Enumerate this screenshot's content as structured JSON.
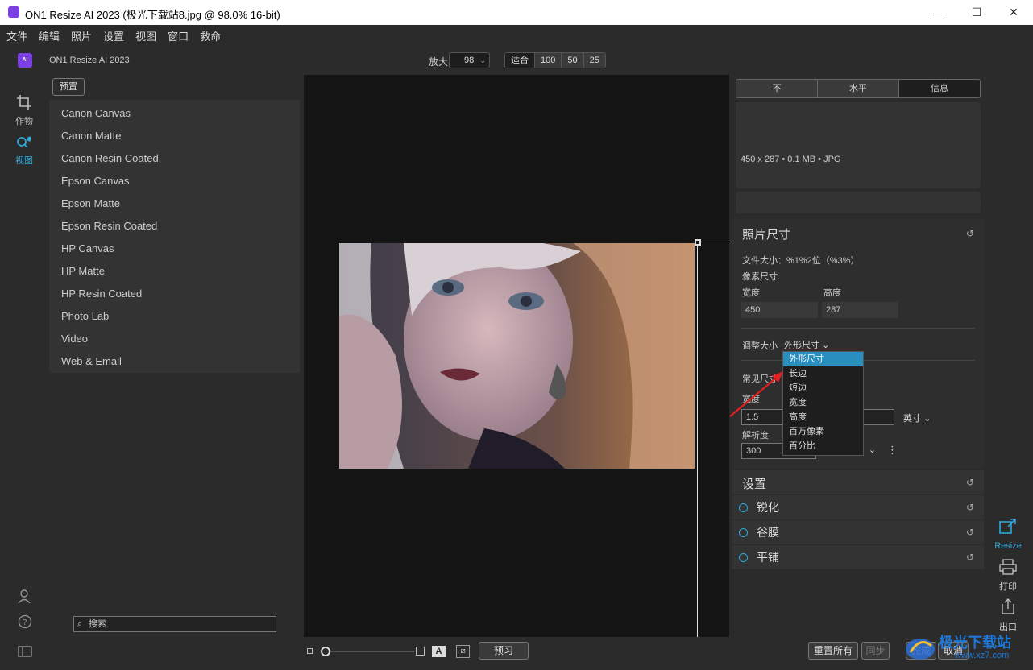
{
  "window": {
    "title": "ON1 Resize AI 2023 (极光下载站8.jpg @ 98.0% 16-bit)",
    "controls": [
      "—",
      "☐",
      "✕"
    ]
  },
  "menu": [
    "文件",
    "编辑",
    "照片",
    "设置",
    "视图",
    "窗口",
    "救命"
  ],
  "toolbar": {
    "logo_text": "AI",
    "app_name": "ON1 Resize AI 2023",
    "zoom_label": "放大",
    "zoom_value": "98",
    "zoom_buttons": [
      "适合",
      "100",
      "50",
      "25"
    ]
  },
  "left_rail": {
    "crop_label": "作物",
    "view_label": "视图"
  },
  "presets": {
    "button_label": "预置",
    "items": [
      "Canon Canvas",
      "Canon Matte",
      "Canon Resin Coated",
      "Epson Canvas",
      "Epson Matte",
      "Epson Resin Coated",
      "HP Canvas",
      "HP Matte",
      "HP Resin Coated",
      "Photo Lab",
      "Video",
      "Web & Email"
    ],
    "search_placeholder": "搜索"
  },
  "bottom": {
    "a_label": "A",
    "preview_label": "预习",
    "reset_all_label": "重置所有",
    "sync_label": "同步",
    "done_label": "完成",
    "cancel_label": "取消"
  },
  "right_panel": {
    "tabs": [
      "不",
      "水平",
      "信息"
    ],
    "info_text": "450 x 287 • 0.1 MB • JPG",
    "photo_size": {
      "title": "照片尺寸",
      "file_size_label": "文件大小：%1%2位（%3%）",
      "pixel_dims_label": "像素尺寸:",
      "width_label": "宽度",
      "height_label": "高度",
      "width_value": "450",
      "height_value": "287",
      "resize_label": "调整大小",
      "resize_mode": "外形尺寸",
      "common_label": "常见尺寸",
      "width2_label": "宽度",
      "width2_value": "1.5",
      "unit_value": "英寸",
      "resolution_label": "解析度",
      "resolution_value": "300"
    },
    "settings": {
      "title": "设置",
      "items": [
        "锐化",
        "谷膜",
        "平铺"
      ]
    },
    "dropdown": [
      "外形尺寸",
      "长边",
      "短边",
      "宽度",
      "高度",
      "百万像素",
      "百分比"
    ]
  },
  "right_rail": {
    "resize_label": "Resize",
    "print_label": "打印",
    "export_label": "出口"
  },
  "watermark": {
    "text": "极光下载站",
    "url": "www.xz7.com"
  },
  "colors": {
    "accent": "#2a8fbf",
    "brand": "#7b3fe4",
    "bg": "#2b2b2b",
    "canvas": "#141414"
  }
}
